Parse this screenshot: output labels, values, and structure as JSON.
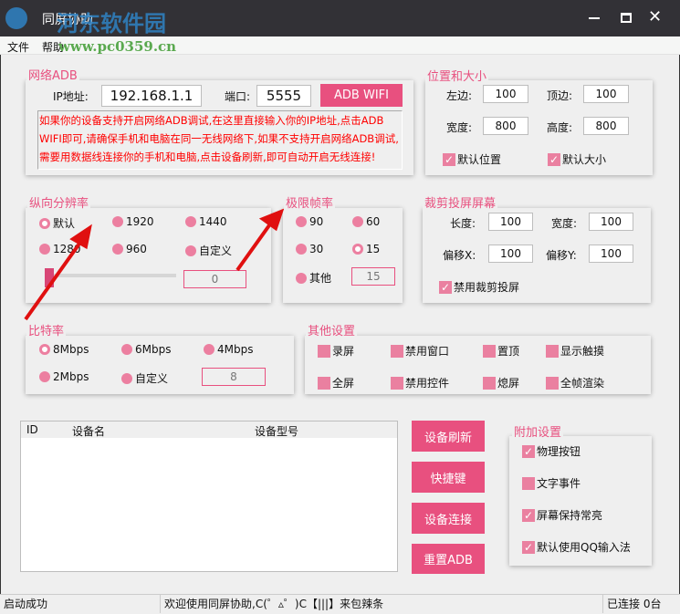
{
  "window": {
    "title": "同屏协助",
    "watermark": "河东软件园",
    "watermark_url": "www.pc0359.cn",
    "controls": [
      "minimize",
      "maximize",
      "close"
    ]
  },
  "menu": [
    "文件",
    "帮助"
  ],
  "adb": {
    "title": "网络ADB",
    "ip_label": "IP地址:",
    "ip_value": "192.168.1.1",
    "port_label": "端口:",
    "port_value": "5555",
    "button": "ADB WIFI",
    "note": "如果你的设备支持开启网络ADB调试,在这里直接输入你的IP地址,点击ADB WIFI即可,请确保手机和电脑在同一无线网络下,如果不支持开启网络ADB调试,需要用数据线连接你的手机和电脑,点击设备刷新,即可自动开启无线连接!"
  },
  "position": {
    "title": "位置和大小",
    "left_label": "左边:",
    "left": "100",
    "top_label": "顶边:",
    "top": "100",
    "width_label": "宽度:",
    "width": "800",
    "height_label": "高度:",
    "height": "800",
    "default_pos": "默认位置",
    "default_size": "默认大小"
  },
  "resolution": {
    "title": "纵向分辨率",
    "options": [
      "默认",
      "1920",
      "1440",
      "1280",
      "960",
      "自定义"
    ],
    "selected": "默认",
    "slider_value": 0,
    "custom_value": "0"
  },
  "fps": {
    "title": "极限帧率",
    "options": [
      "90",
      "60",
      "30",
      "15",
      "其他"
    ],
    "selected": "15",
    "custom_value": "15"
  },
  "crop": {
    "title": "裁剪投屏屏幕",
    "length_label": "长度:",
    "length": "100",
    "width_label": "宽度:",
    "width": "100",
    "offx_label": "偏移X:",
    "offx": "100",
    "offy_label": "偏移Y:",
    "offy": "100",
    "disable": "禁用裁剪投屏"
  },
  "bitrate": {
    "title": "比特率",
    "options": [
      "8Mbps",
      "6Mbps",
      "4Mbps",
      "2Mbps",
      "自定义"
    ],
    "selected": "8Mbps",
    "custom_value": "8"
  },
  "other": {
    "title": "其他设置",
    "items": [
      "录屏",
      "禁用窗口",
      "置顶",
      "显示触摸",
      "全屏",
      "禁用控件",
      "熄屏",
      "全帧渲染"
    ]
  },
  "devices": {
    "columns": [
      "ID",
      "设备名",
      "设备型号"
    ],
    "rows": []
  },
  "actions": [
    "设备刷新",
    "快捷键",
    "设备连接",
    "重置ADB"
  ],
  "extra": {
    "title": "附加设置",
    "items": [
      {
        "label": "物理按钮",
        "checked": true
      },
      {
        "label": "文字事件",
        "checked": false
      },
      {
        "label": "屏幕保持常亮",
        "checked": true
      },
      {
        "label": "默认使用QQ输入法",
        "checked": true
      }
    ]
  },
  "statusbar": {
    "left": "启动成功",
    "center": "欢迎使用同屏协助,C(゜▵゜)C【|||】来包辣条",
    "right": "已连接 0台"
  },
  "colors": {
    "accent": "#e8507f",
    "radio": "#ec7fa0",
    "titlebar": "#323136",
    "note_text": "#ff0000"
  }
}
